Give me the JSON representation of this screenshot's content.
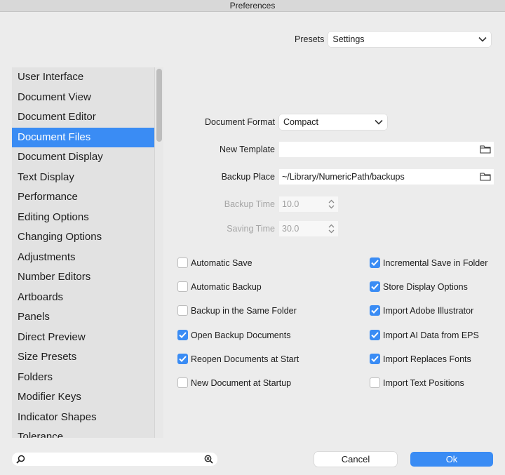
{
  "window": {
    "title": "Preferences"
  },
  "presets": {
    "label": "Presets",
    "value": "Settings"
  },
  "sidebar": {
    "items": [
      {
        "label": "User Interface",
        "selected": false
      },
      {
        "label": "Document View",
        "selected": false
      },
      {
        "label": "Document Editor",
        "selected": false
      },
      {
        "label": "Document Files",
        "selected": true
      },
      {
        "label": "Document Display",
        "selected": false
      },
      {
        "label": "Text Display",
        "selected": false
      },
      {
        "label": "Performance",
        "selected": false
      },
      {
        "label": "Editing Options",
        "selected": false
      },
      {
        "label": "Changing Options",
        "selected": false
      },
      {
        "label": "Adjustments",
        "selected": false
      },
      {
        "label": "Number Editors",
        "selected": false
      },
      {
        "label": "Artboards",
        "selected": false
      },
      {
        "label": "Panels",
        "selected": false
      },
      {
        "label": "Direct Preview",
        "selected": false
      },
      {
        "label": "Size Presets",
        "selected": false
      },
      {
        "label": "Folders",
        "selected": false
      },
      {
        "label": "Modifier Keys",
        "selected": false
      },
      {
        "label": "Indicator Shapes",
        "selected": false
      },
      {
        "label": "Tolerance",
        "selected": false
      }
    ]
  },
  "form": {
    "document_format": {
      "label": "Document Format",
      "value": "Compact"
    },
    "new_template": {
      "label": "New Template",
      "value": ""
    },
    "backup_place": {
      "label": "Backup Place",
      "value": "~/Library/NumericPath/backups"
    },
    "backup_time": {
      "label": "Backup Time",
      "value": "10.0"
    },
    "saving_time": {
      "label": "Saving Time",
      "value": "30.0"
    }
  },
  "checkboxes_left": [
    {
      "label": "Automatic Save",
      "checked": false
    },
    {
      "label": "Automatic Backup",
      "checked": false
    },
    {
      "label": "Backup in the Same Folder",
      "checked": false
    },
    {
      "label": "Open Backup Documents",
      "checked": true
    },
    {
      "label": "Reopen Documents at Start",
      "checked": true
    },
    {
      "label": "New Document at Startup",
      "checked": false
    }
  ],
  "checkboxes_right": [
    {
      "label": "Incremental Save in Folder",
      "checked": true
    },
    {
      "label": "Store Display Options",
      "checked": true
    },
    {
      "label": "Import Adobe Illustrator",
      "checked": true
    },
    {
      "label": "Import AI Data from EPS",
      "checked": true
    },
    {
      "label": "Import Replaces Fonts",
      "checked": true
    },
    {
      "label": "Import Text Positions",
      "checked": false
    }
  ],
  "search": {
    "placeholder": ""
  },
  "buttons": {
    "cancel": "Cancel",
    "ok": "Ok"
  },
  "colors": {
    "accent": "#3a8cf4",
    "sidebar_bg": "#e2e2e2",
    "window_bg": "#ececec"
  }
}
